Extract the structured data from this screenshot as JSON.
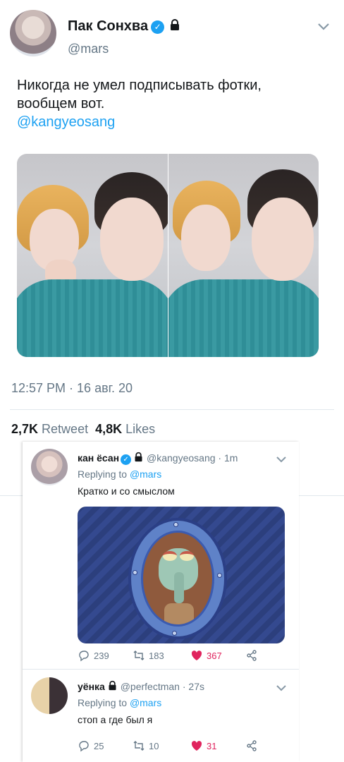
{
  "main_tweet": {
    "author_name": "Пак Сонхва",
    "author_handle": "@mars",
    "text_line1": "Никогда не умел подписывать фотки,",
    "text_line2": "вообщем вот.",
    "mention": "@kangyeosang",
    "timestamp": "12:57 PM · 16 авг. 20",
    "retweets_count": "2,7K",
    "retweets_label": "Retweet",
    "likes_count": "4,8K",
    "likes_label": "Likes"
  },
  "replies": [
    {
      "name": "кан ёсан",
      "handle": "@kangyeosang",
      "time": "· 1m",
      "verified": true,
      "protected": true,
      "replying_prefix": "Replying to",
      "replying_to": "@mars",
      "text": "Кратко и со смыслом",
      "has_media": true,
      "reply_count": "239",
      "retweet_count": "183",
      "like_count": "367"
    },
    {
      "name": "уёнка",
      "handle": "@perfectman",
      "time": "· 27s",
      "verified": false,
      "protected": true,
      "replying_prefix": "Replying to",
      "replying_to": "@mars",
      "text": "стоп а где был я",
      "has_media": false,
      "reply_count": "25",
      "retweet_count": "10",
      "like_count": "31"
    }
  ],
  "colors": {
    "accent": "#1da1f2",
    "muted": "#657786",
    "like": "#e0245e",
    "text": "#14171a"
  },
  "icons": {
    "verified": "verified-badge-icon",
    "protected": "lock-icon",
    "more": "chevron-down-icon",
    "reply": "reply-icon",
    "retweet": "retweet-icon",
    "like": "heart-icon",
    "share": "share-icon"
  }
}
